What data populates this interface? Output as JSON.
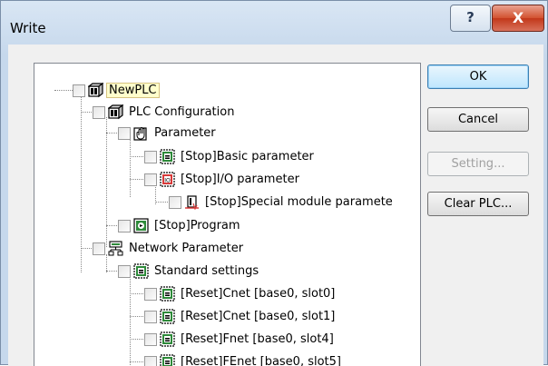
{
  "window": {
    "title": "Write"
  },
  "titlebar": {
    "help_glyph": "?",
    "close_glyph": "X"
  },
  "tree": {
    "items": [
      {
        "label": "NewPLC",
        "icon": "plc-icon",
        "selected": true
      },
      {
        "label": "PLC Configuration",
        "icon": "plc-icon"
      },
      {
        "label": "Parameter",
        "icon": "hand-icon"
      },
      {
        "label": "[Stop]Basic parameter",
        "icon": "parameter-icon"
      },
      {
        "label": "[Stop]I/O parameter",
        "icon": "io-parameter-icon"
      },
      {
        "label": "[Stop]Special module paramete",
        "icon": "special-module-icon"
      },
      {
        "label": "[Stop]Program",
        "icon": "program-icon"
      },
      {
        "label": "Network Parameter",
        "icon": "network-icon"
      },
      {
        "label": "Standard settings",
        "icon": "parameter-icon"
      },
      {
        "label": "[Reset]Cnet [base0, slot0]",
        "icon": "parameter-icon"
      },
      {
        "label": "[Reset]Cnet [base0, slot1]",
        "icon": "parameter-icon"
      },
      {
        "label": "[Reset]Fnet [base0, slot4]",
        "icon": "parameter-icon"
      },
      {
        "label": "[Reset]FEnet [base0, slot5]",
        "icon": "parameter-icon"
      }
    ]
  },
  "buttons": {
    "ok": "OK",
    "cancel": "Cancel",
    "setting": "Setting...",
    "clear_plc": "Clear PLC..."
  }
}
